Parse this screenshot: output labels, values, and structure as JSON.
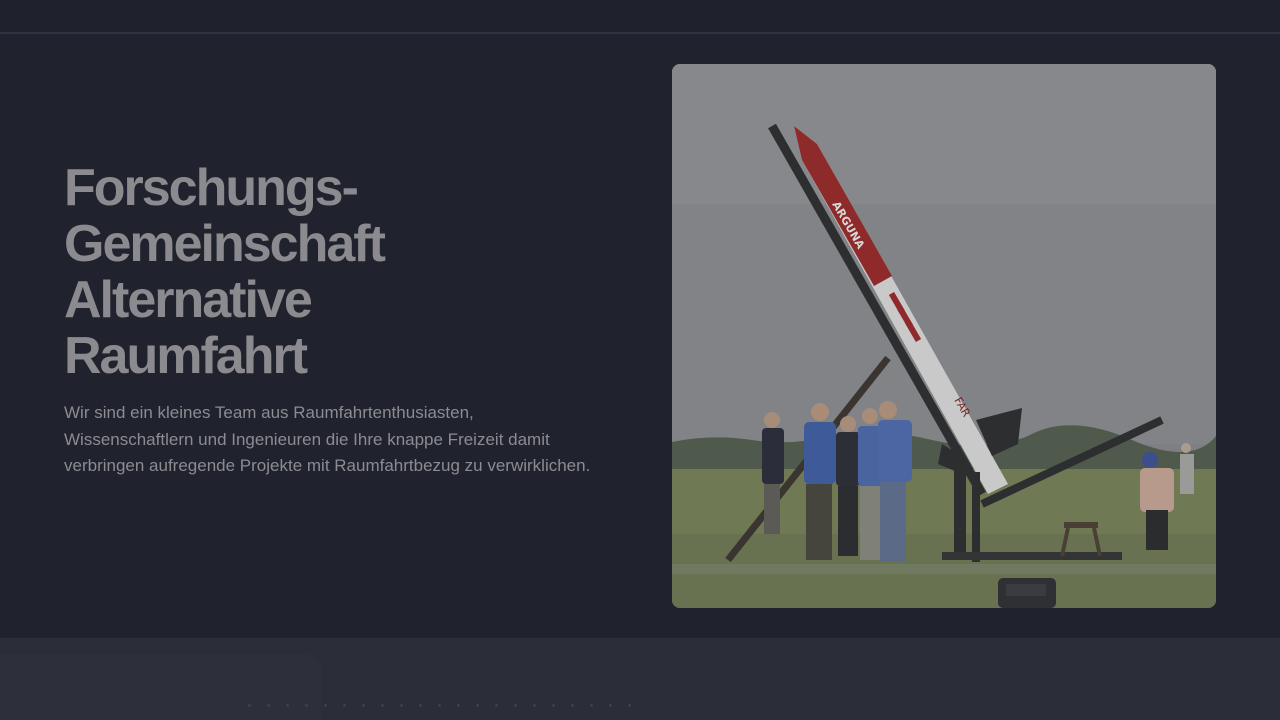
{
  "hero": {
    "title": "Forschungs-\nGemeinschaft\nAlternative\nRaumfahrt",
    "description": "Wir sind ein kleines Team aus Raumfahrtenthusiasten, Wissenschaftlern und Ingenieuren die Ihre knappe Freizeit damit verbringen aufregende Projekte mit Raumfahrtbezug zu verwirklichen.",
    "photo": {
      "rocket_label": "ARGUNA",
      "fin_label": "FAR"
    }
  },
  "colors": {
    "background": "#20222e",
    "title": "#8b8b8f",
    "text": "#8c8c90",
    "rocket_red": "#8e2a2a",
    "grass": "#6f7a55"
  }
}
